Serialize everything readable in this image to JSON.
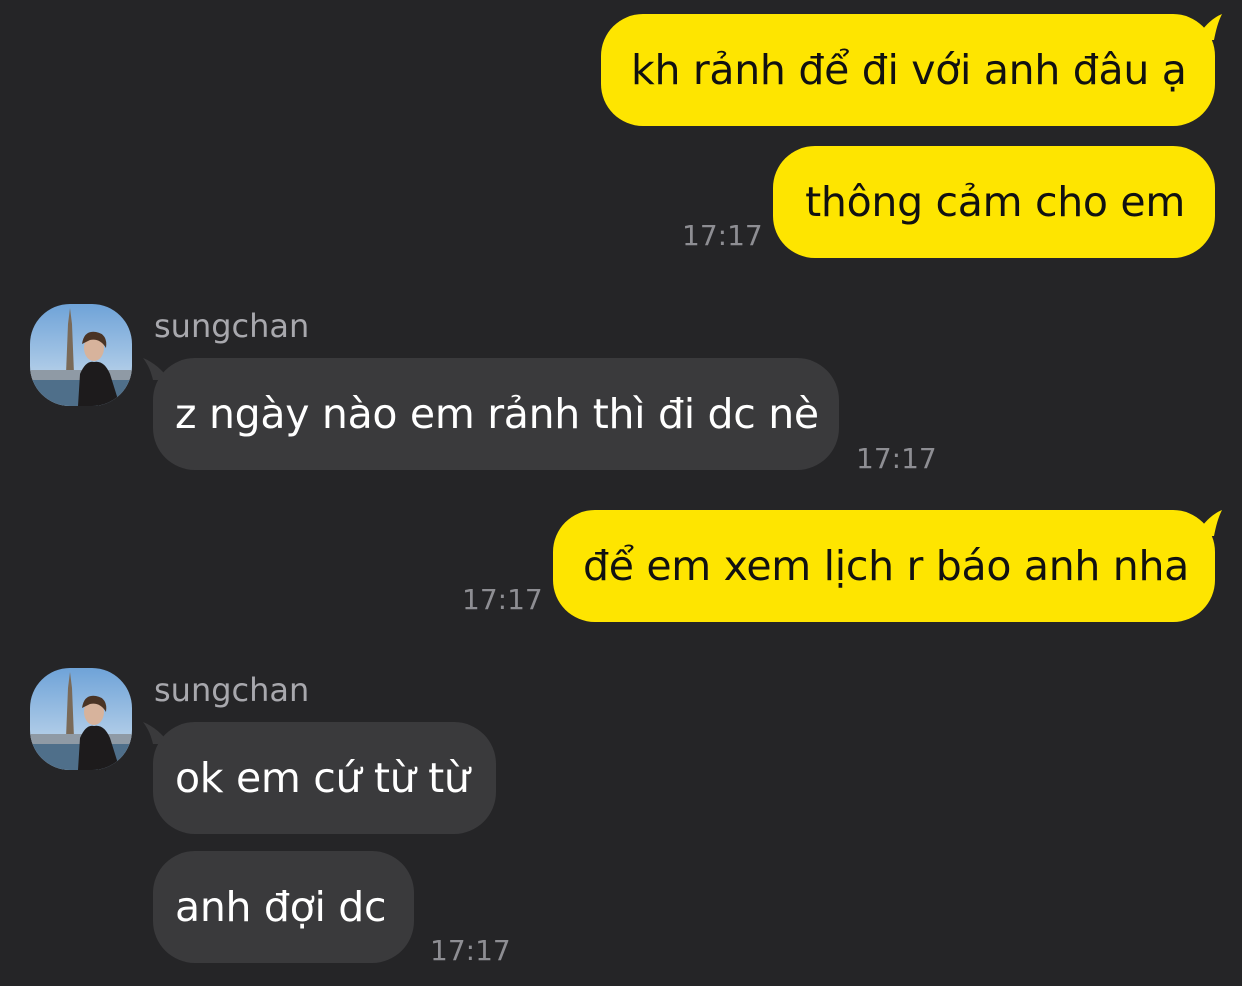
{
  "contact": {
    "name": "sungchan"
  },
  "messages": [
    {
      "from": "me",
      "text": "kh rảnh để đi với anh đâu ạ"
    },
    {
      "from": "me",
      "text": "thông cảm cho em",
      "time": "17:17"
    },
    {
      "from": "sungchan",
      "sender": "sungchan",
      "text": "z ngày nào em rảnh thì đi dc nè",
      "time": "17:17"
    },
    {
      "from": "me",
      "text": "để em xem lịch r báo anh nha",
      "time": "17:17"
    },
    {
      "from": "sungchan",
      "sender": "sungchan",
      "text": "ok em cứ từ từ"
    },
    {
      "from": "sungchan",
      "text": "anh đợi dc",
      "time": "17:17"
    }
  ],
  "colors": {
    "background": "#252527",
    "outgoing_bubble": "#fee500",
    "incoming_bubble": "#3a3a3c",
    "timestamp": "#8e8e93",
    "sender_name": "#a8a8ad"
  }
}
